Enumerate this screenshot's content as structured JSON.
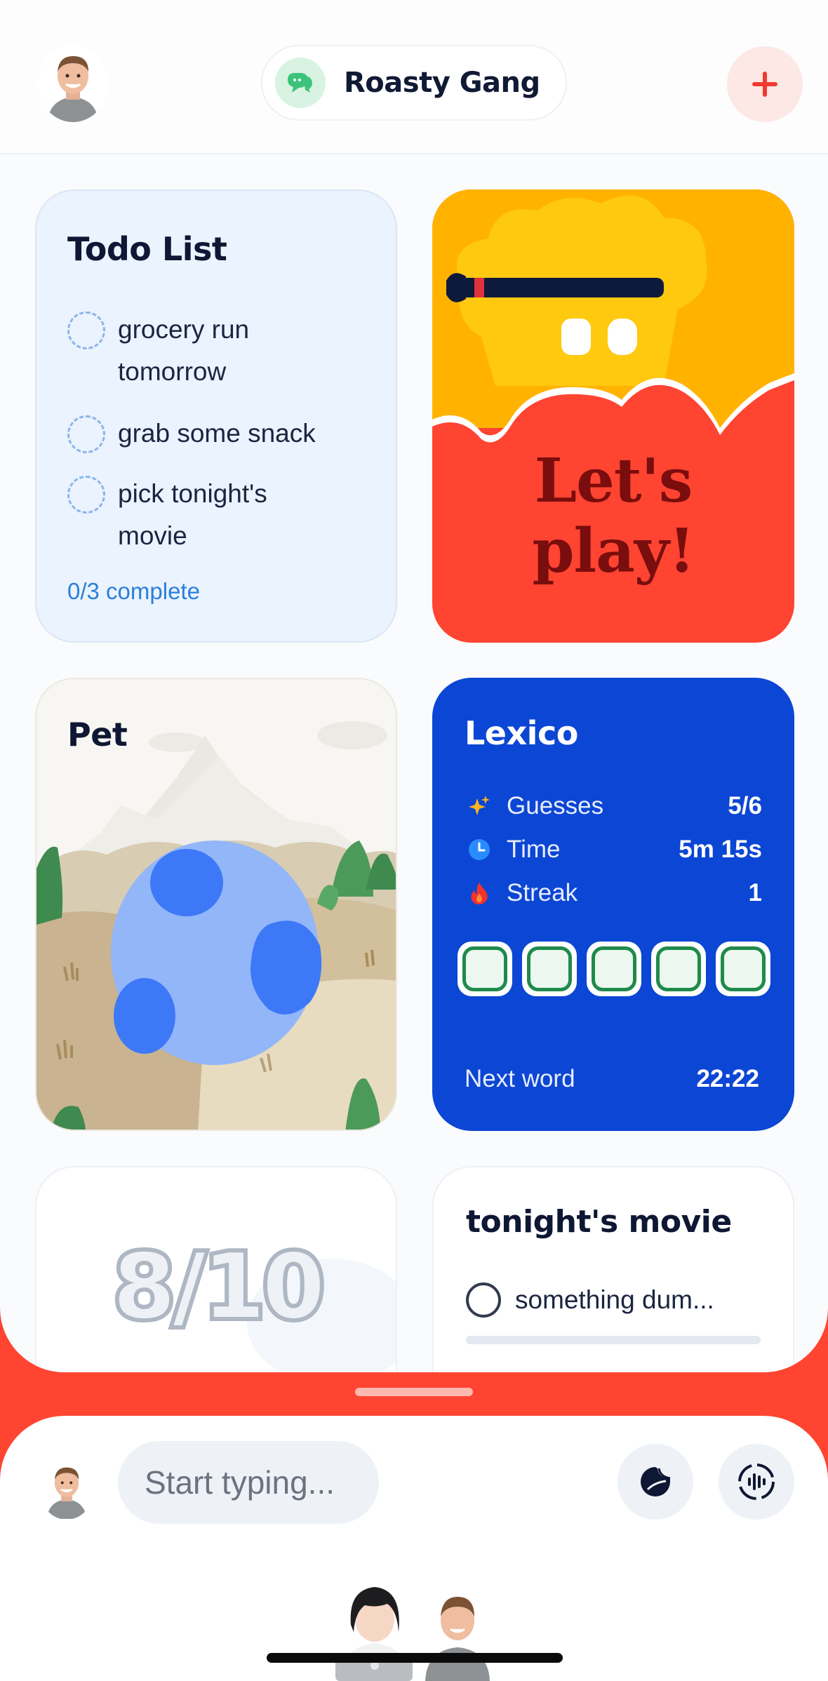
{
  "header": {
    "group_name": "Roasty Gang",
    "add_label": "+"
  },
  "todo": {
    "title": "Todo List",
    "items": [
      {
        "text": "grocery run tomorrow",
        "done": false
      },
      {
        "text": "grab some snack",
        "done": false
      },
      {
        "text": "pick tonight's movie",
        "done": false
      }
    ],
    "progress": "0/3 complete"
  },
  "play": {
    "line1": "Let's",
    "line2": "play!"
  },
  "pet": {
    "title": "Pet"
  },
  "lexico": {
    "title": "Lexico",
    "stats": [
      {
        "icon": "sparkle-icon",
        "label": "Guesses",
        "value": "5/6"
      },
      {
        "icon": "clock-icon",
        "label": "Time",
        "value": "5m 15s"
      },
      {
        "icon": "flame-icon",
        "label": "Streak",
        "value": "1"
      }
    ],
    "next_label": "Next word",
    "next_value": "22:22"
  },
  "score": {
    "value": "8/10"
  },
  "movie": {
    "title": "tonight's movie",
    "option": "something dum..."
  },
  "composer": {
    "placeholder": "Start typing..."
  },
  "colors": {
    "background_red": "#ff4431",
    "lexico_blue": "#0c46d4",
    "todo_bg": "#eaf3fe",
    "accent_blue": "#2b7fd9",
    "tile_green": "#1f8a4c"
  }
}
